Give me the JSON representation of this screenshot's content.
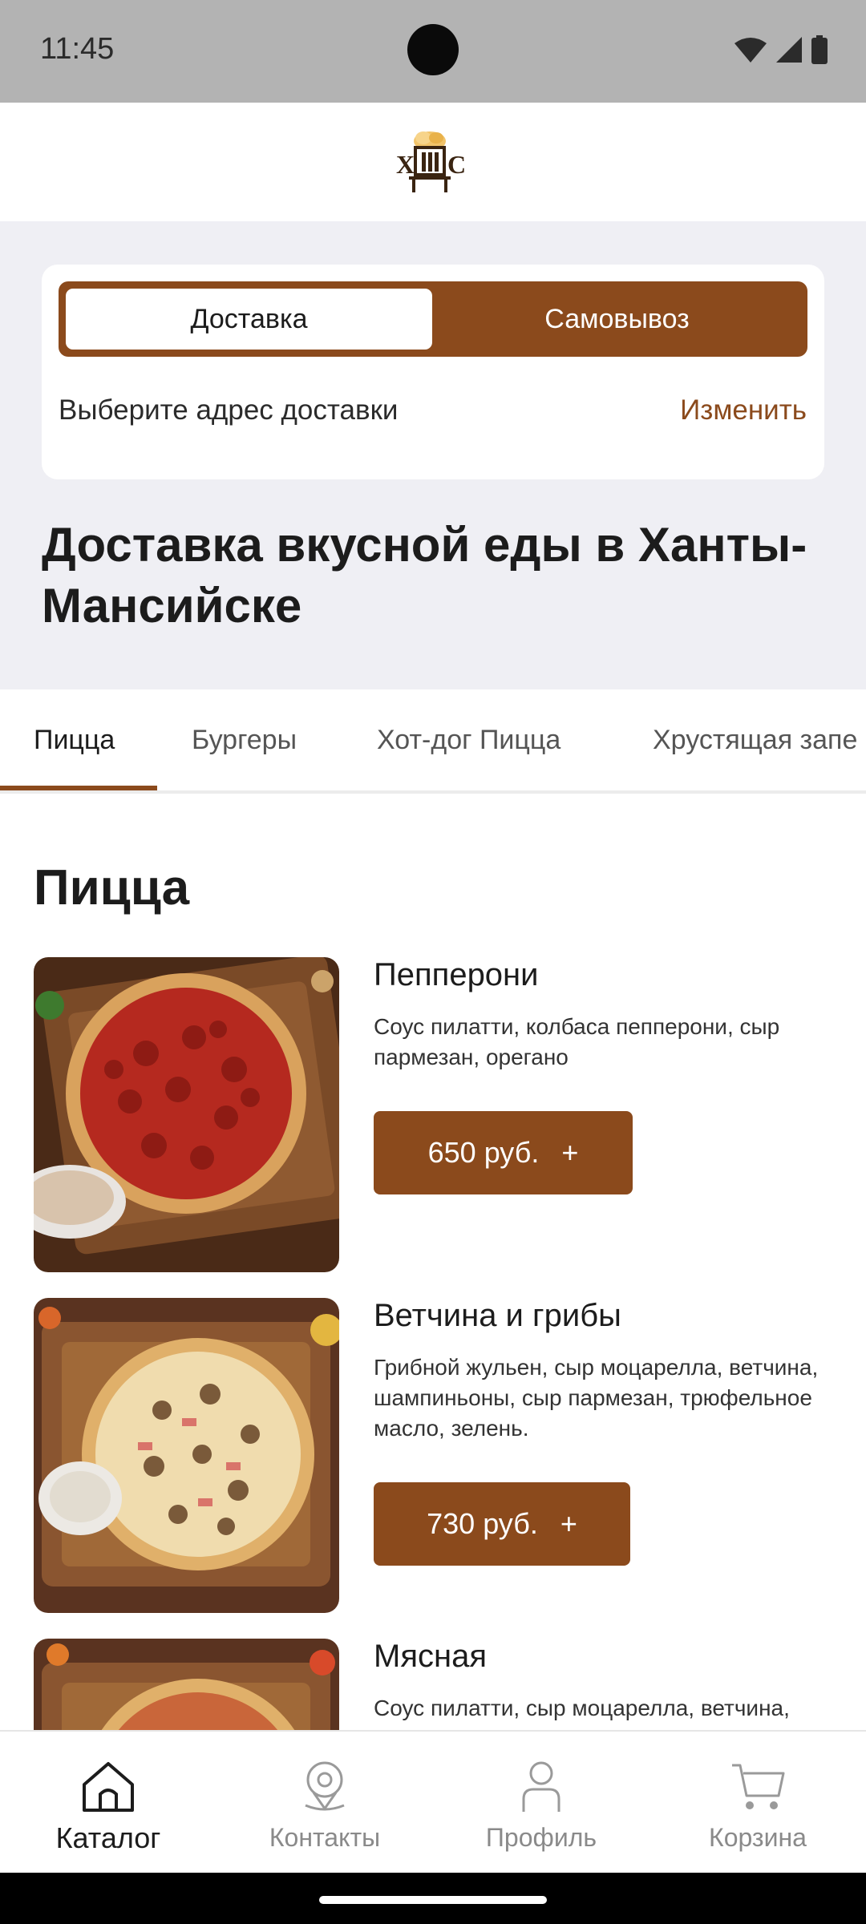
{
  "status_bar": {
    "time": "11:45"
  },
  "header": {
    "logo_text": "ХШС",
    "logo_name": "beer-mug-logo"
  },
  "delivery": {
    "tabs": [
      "Доставка",
      "Самовывоз"
    ],
    "active_tab": "Доставка",
    "address_placeholder": "Выберите адрес доставки",
    "change_label": "Изменить"
  },
  "hero": {
    "title": "Доставка вкусной еды в Ханты-Мансийске"
  },
  "category_tabs": [
    {
      "label": "Пицца",
      "active": true
    },
    {
      "label": "Бургеры",
      "active": false
    },
    {
      "label": "Хот-дог Пицца",
      "active": false
    },
    {
      "label": "Хрустящая запе",
      "active": false
    }
  ],
  "section": {
    "title": "Пицца",
    "products": [
      {
        "name": "Пепперони",
        "description": "Соус пилатти, колбаса пепперони, сыр пармезан, орегано",
        "price": "650 руб.",
        "add_symbol": "+"
      },
      {
        "name": "Ветчина и грибы",
        "description": "Грибной жульен, сыр моцарелла, ветчина, шампиньоны, сыр пармезан, трюфельное масло, зелень.",
        "price": "730 руб.",
        "add_symbol": "+"
      },
      {
        "name": "Мясная",
        "description": "Соус пилатти, сыр моцарелла, ветчина,",
        "price": "",
        "add_symbol": ""
      }
    ]
  },
  "bottom_nav": [
    {
      "label": "Каталог",
      "icon": "home-icon",
      "active": true
    },
    {
      "label": "Контакты",
      "icon": "location-pin-icon",
      "active": false
    },
    {
      "label": "Профиль",
      "icon": "person-icon",
      "active": false
    },
    {
      "label": "Корзина",
      "icon": "cart-icon",
      "active": false
    }
  ],
  "colors": {
    "brand": "#8b4a1c",
    "background_gray": "#efeff4",
    "status_bar": "#b3b3b3"
  }
}
